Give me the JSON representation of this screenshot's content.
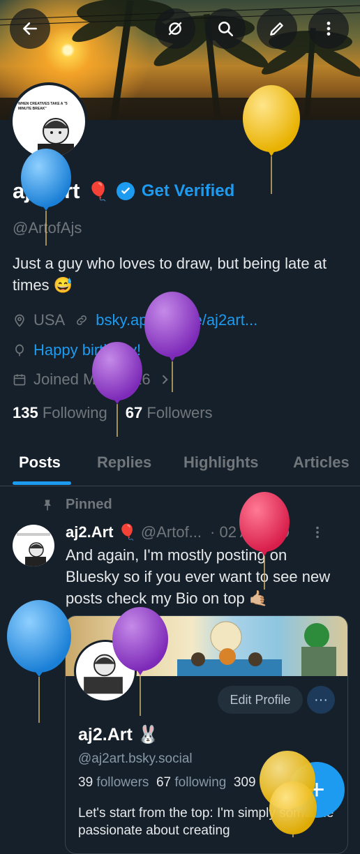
{
  "header": {
    "back_icon": "arrow-left-icon",
    "actions": [
      "bluesky-off-icon",
      "search-icon",
      "edit-icon",
      "more-vertical-icon"
    ]
  },
  "profile": {
    "name": "aj2.Art",
    "name_emoji": "🎈",
    "get_verified": "Get Verified",
    "handle": "@ArtofAjs",
    "bio": "Just a guy who loves to draw, but being late at times 😅",
    "location": "USA",
    "website": "bsky.app/profile/aj2art...",
    "birthday": "Happy birthday!",
    "joined": "Joined May 2016",
    "following_count": "135",
    "following_label": "Following",
    "followers_count": "67",
    "followers_label": "Followers",
    "avatar_caption": "WHEN CREATIVES TAKE A \"5 MINUTE BREAK\""
  },
  "tabs": [
    "Posts",
    "Replies",
    "Highlights",
    "Articles"
  ],
  "post": {
    "pinned_label": "Pinned",
    "name": "aj2.Art",
    "name_emoji": "🎈",
    "handle": "@Artof...",
    "date": "· 02 Apr",
    "text": "And again, I'm mostly posting on Bluesky so if you ever want to see new posts check my Bio on top 🤙🏼",
    "embed": {
      "edit_profile": "Edit Profile",
      "more": "···",
      "name": "aj2.Art 🐰",
      "handle": "@aj2art.bsky.social",
      "followers_count": "39",
      "followers_label": "followers",
      "following_count": "67",
      "following_label": "following",
      "posts_count": "309",
      "desc": "Let's start from the top: I'm simply someone passionate about creating"
    }
  },
  "fab_label": "+",
  "colors": {
    "accent": "#1d9bf0",
    "background": "#15202b",
    "muted": "#71767b"
  }
}
